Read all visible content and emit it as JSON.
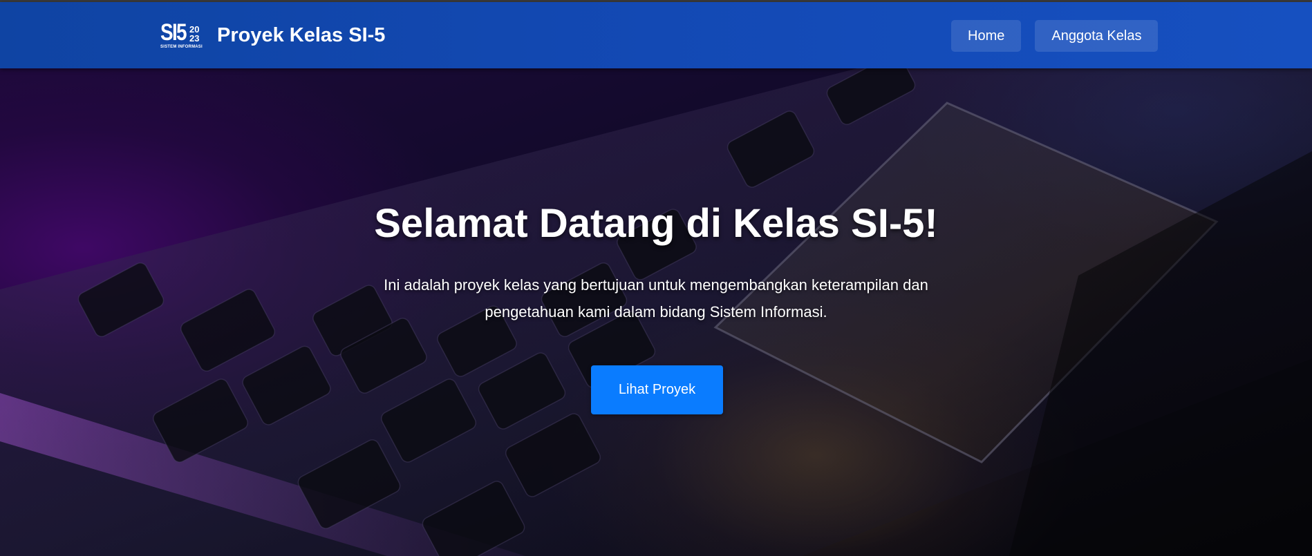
{
  "navbar": {
    "logo": {
      "main": "SI5",
      "year_top": "20",
      "year_bottom": "23",
      "subtitle": "SISTEM INFORMASI"
    },
    "title": "Proyek Kelas SI-5",
    "links": [
      {
        "label": "Home"
      },
      {
        "label": "Anggota Kelas"
      }
    ]
  },
  "hero": {
    "title": "Selamat Datang di Kelas SI-5!",
    "description": "Ini adalah proyek kelas yang bertujuan untuk mengembangkan keterampilan dan pengetahuan kami dalam bidang Sistem Informasi.",
    "cta_label": "Lihat Proyek",
    "background_image": "laptop-keyboard-trackpad-dark-purple"
  },
  "colors": {
    "navbar": "#1349b4",
    "cta": "#0a7cff",
    "hero_purple": "#46086e"
  }
}
